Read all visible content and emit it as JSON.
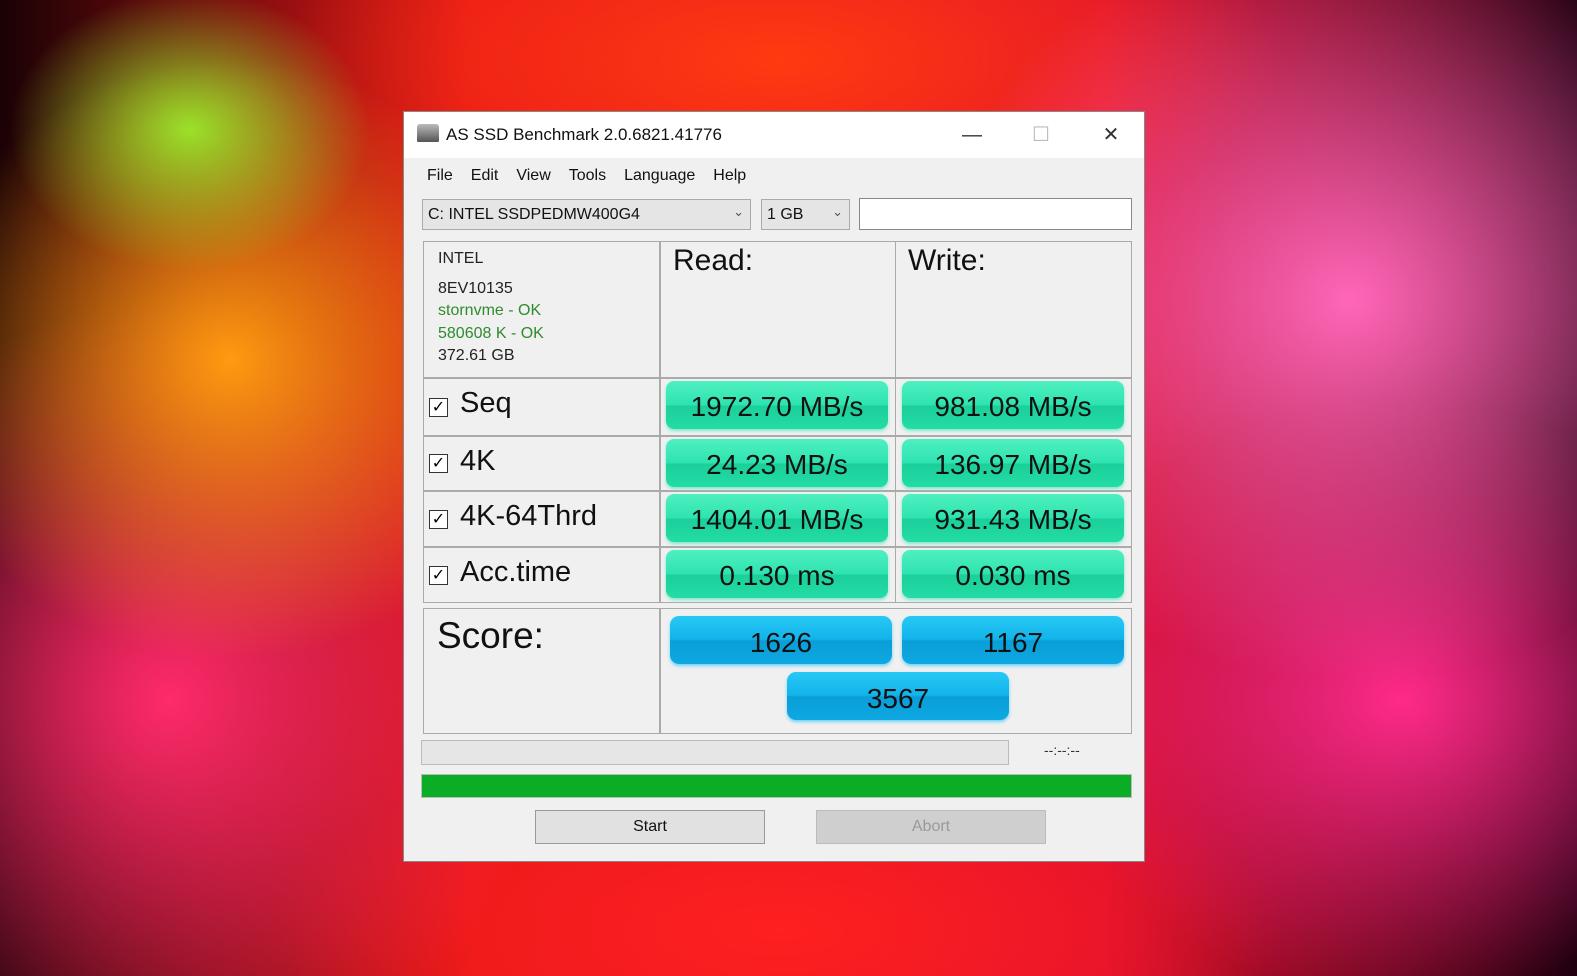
{
  "window": {
    "title": "AS SSD Benchmark 2.0.6821.41776"
  },
  "menu": [
    "File",
    "Edit",
    "View",
    "Tools",
    "Language",
    "Help"
  ],
  "drive_select": {
    "value": "C: INTEL SSDPEDMW400G4"
  },
  "size_select": {
    "value": "1 GB"
  },
  "drive_info": {
    "vendor": "INTEL",
    "firmware": "8EV10135",
    "driver": "stornvme - OK",
    "alignment": "580608 K - OK",
    "capacity": "372.61 GB"
  },
  "headers": {
    "read": "Read:",
    "write": "Write:"
  },
  "rows": [
    {
      "label": "Seq",
      "checked": true,
      "read": "1972.70 MB/s",
      "write": "981.08 MB/s"
    },
    {
      "label": "4K",
      "checked": true,
      "read": "24.23 MB/s",
      "write": "136.97 MB/s"
    },
    {
      "label": "4K-64Thrd",
      "checked": true,
      "read": "1404.01 MB/s",
      "write": "931.43 MB/s"
    },
    {
      "label": "Acc.time",
      "checked": true,
      "read": "0.130 ms",
      "write": "0.030 ms"
    }
  ],
  "score": {
    "label": "Score:",
    "read": "1626",
    "write": "1167",
    "total": "3567"
  },
  "progress": {
    "time": "--:--:--",
    "current_fraction": 0,
    "overall_fraction": 1.0,
    "bar_color": "#0aad25"
  },
  "buttons": {
    "start": "Start",
    "abort": "Abort"
  }
}
